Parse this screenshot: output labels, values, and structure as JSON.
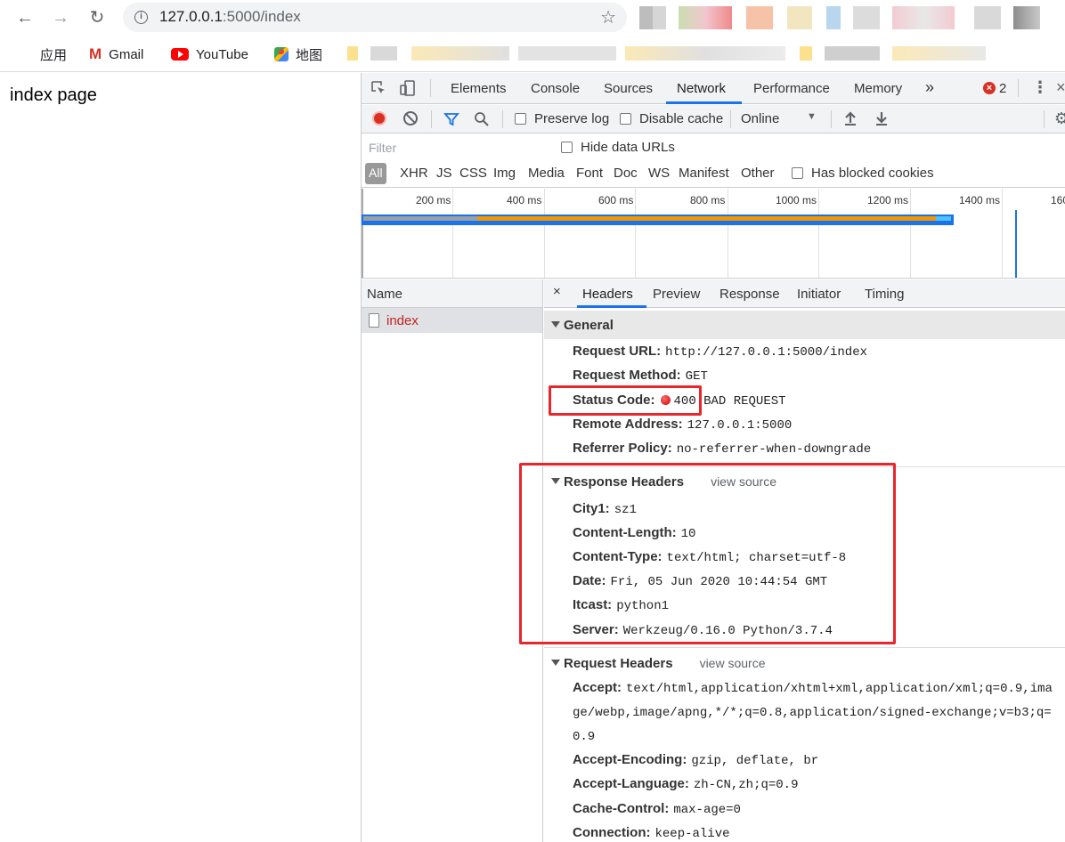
{
  "browser": {
    "url_host": "127.0.0.1",
    "url_rest": ":5000/index",
    "bookmarks": [
      {
        "label": "应用"
      },
      {
        "label": "Gmail"
      },
      {
        "label": "YouTube"
      },
      {
        "label": "地图"
      }
    ]
  },
  "page": {
    "content": "index page"
  },
  "devtools": {
    "tabs": [
      "Elements",
      "Console",
      "Sources",
      "Network",
      "Performance",
      "Memory"
    ],
    "active_tab": "Network",
    "more_tabs": "»",
    "error_count": "2",
    "toolbar": {
      "preserve_log": "Preserve log",
      "disable_cache": "Disable cache",
      "throttling": "Online"
    },
    "filter": {
      "placeholder": "Filter",
      "hide_data_urls": "Hide data URLs",
      "types": [
        "All",
        "XHR",
        "JS",
        "CSS",
        "Img",
        "Media",
        "Font",
        "Doc",
        "WS",
        "Manifest",
        "Other"
      ],
      "has_blocked_cookies": "Has blocked cookies"
    },
    "timeline": {
      "ticks": [
        "200 ms",
        "400 ms",
        "600 ms",
        "800 ms",
        "1000 ms",
        "1200 ms",
        "1400 ms",
        "160"
      ]
    },
    "request_list": {
      "header": "Name",
      "rows": [
        {
          "name": "index"
        }
      ]
    },
    "detail": {
      "close": "×",
      "tabs": [
        "Headers",
        "Preview",
        "Response",
        "Initiator",
        "Timing"
      ],
      "active_tab": "Headers",
      "general": {
        "title": "General",
        "rows": [
          {
            "key": "Request URL:",
            "value": "http://127.0.0.1:5000/index"
          },
          {
            "key": "Request Method:",
            "value": "GET"
          },
          {
            "key": "Status Code:",
            "value": "400 BAD REQUEST"
          },
          {
            "key": "Remote Address:",
            "value": "127.0.0.1:5000"
          },
          {
            "key": "Referrer Policy:",
            "value": "no-referrer-when-downgrade"
          }
        ],
        "status_color": "#d93025"
      },
      "response_headers": {
        "title": "Response Headers",
        "view_source": "view source",
        "rows": [
          {
            "key": "City1:",
            "value": "sz1"
          },
          {
            "key": "Content-Length:",
            "value": "10"
          },
          {
            "key": "Content-Type:",
            "value": "text/html; charset=utf-8"
          },
          {
            "key": "Date:",
            "value": "Fri, 05 Jun 2020 10:44:54 GMT"
          },
          {
            "key": "Itcast:",
            "value": "python1"
          },
          {
            "key": "Server:",
            "value": "Werkzeug/0.16.0 Python/3.7.4"
          }
        ]
      },
      "request_headers": {
        "title": "Request Headers",
        "view_source": "view source",
        "rows": [
          {
            "key": "Accept:",
            "value": "text/html,application/xhtml+xml,application/xml;q=0.9,image/webp,image/apng,*/*;q=0.8,application/signed-exchange;v=b3;q=0.9"
          },
          {
            "key": "Accept-Encoding:",
            "value": "gzip, deflate, br"
          },
          {
            "key": "Accept-Language:",
            "value": "zh-CN,zh;q=0.9"
          },
          {
            "key": "Cache-Control:",
            "value": "max-age=0"
          },
          {
            "key": "Connection:",
            "value": "keep-alive"
          }
        ]
      }
    }
  },
  "colors": {
    "accent": "#1a73e8",
    "annotation": "#e8262b",
    "error_link": "#c5221f"
  }
}
